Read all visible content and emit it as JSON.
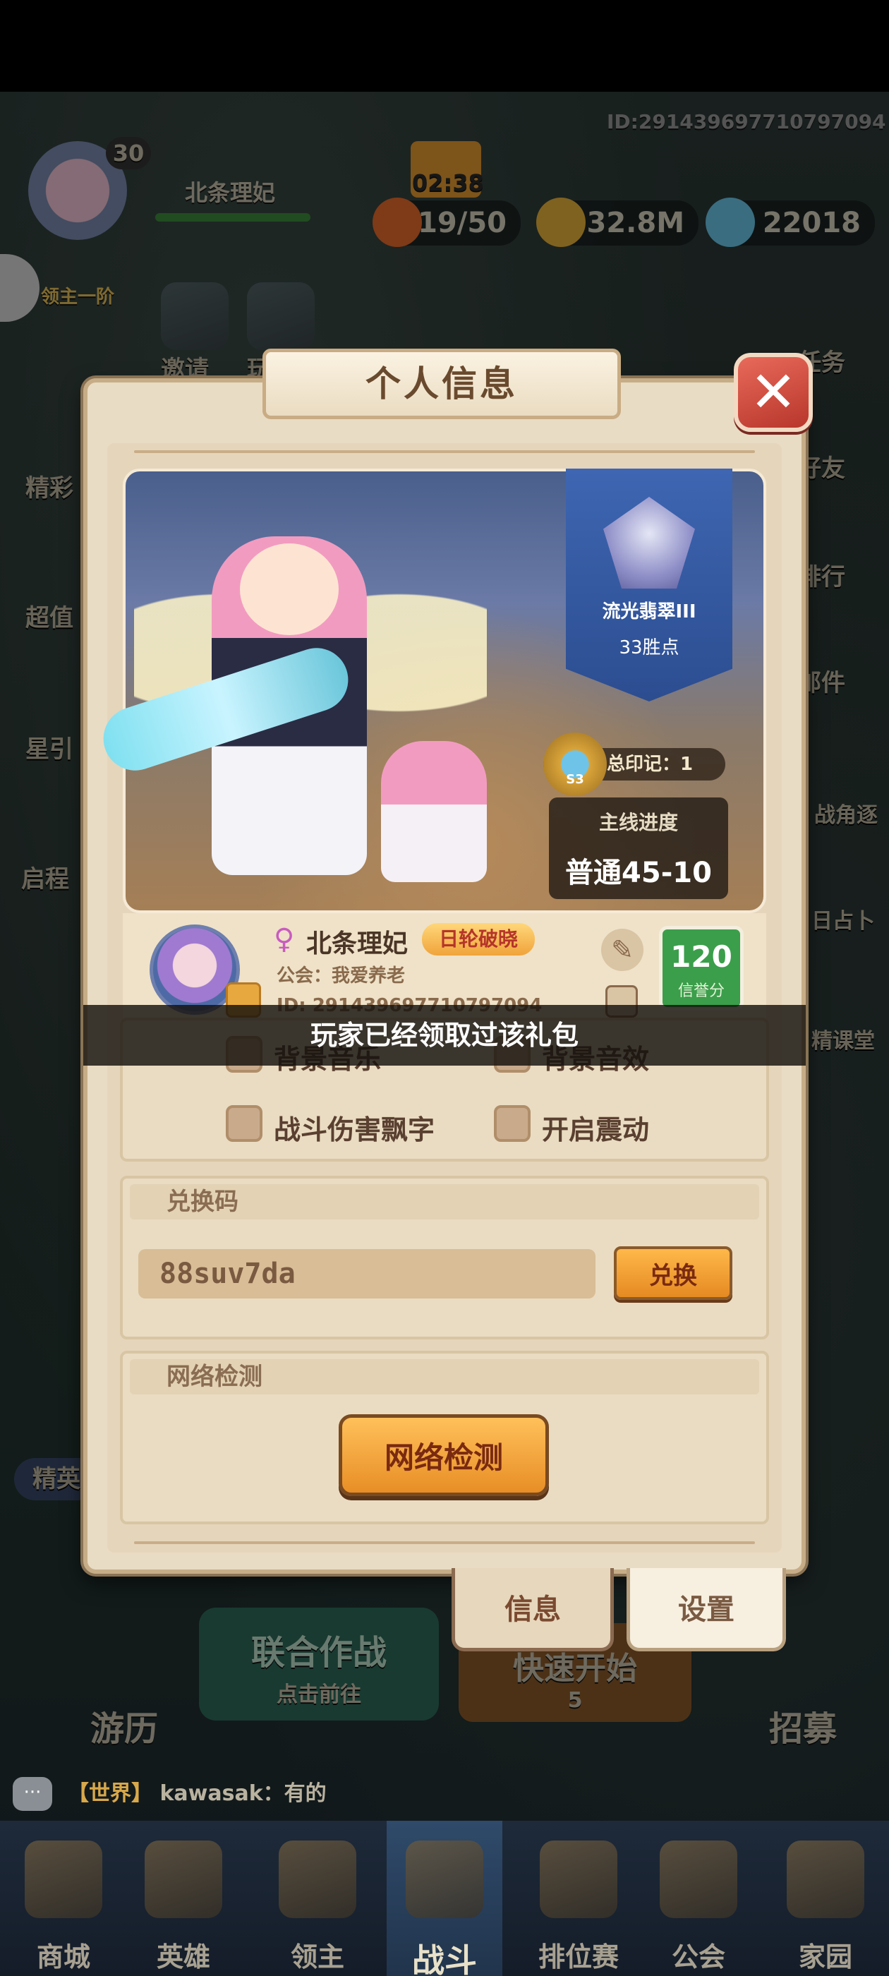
{
  "status": {
    "player_id": "ID:291439697710797094"
  },
  "hud": {
    "avatar_level": "30",
    "player_name": "北条理妃",
    "lord_tag": "领主一阶",
    "timer": "02:38",
    "energy": "19/50",
    "gold": "32.8M",
    "gems": "22018"
  },
  "side_left": [
    "邀请",
    "玩法入口",
    "精彩",
    "超值",
    "星引",
    "启程",
    "精英"
  ],
  "side_right": [
    "任务",
    "好友",
    "排行",
    "邮件",
    "战角逐",
    "日占卜",
    "精课堂"
  ],
  "modal": {
    "title": "个人信息",
    "close_icon": "close-icon",
    "rank": {
      "name": "流光翡翠III",
      "points": "33胜点"
    },
    "badge": {
      "season": "S3",
      "total_marks": "总印记：1"
    },
    "progress": {
      "label": "主线进度",
      "value": "普通45-10"
    },
    "player": {
      "name": "北条理妃",
      "title_tag": "日轮破晓",
      "guild": "公会：我爱养老",
      "id": "ID: 291439697710797094",
      "credit_value": "120",
      "credit_label": "信誉分"
    },
    "toast": "玩家已经领取过该礼包",
    "settings": {
      "bgm_label": "背景音乐",
      "sfx_label": "背景音效",
      "damage_text_label": "战斗伤害飘字",
      "vibration_label": "开启震动"
    },
    "redeem": {
      "header": "兑换码",
      "code_value": "88suv7da",
      "button_label": "兑换"
    },
    "network": {
      "header": "网络检测",
      "button_label": "网络检测"
    },
    "tabs": {
      "info": "信息",
      "settings": "设置"
    }
  },
  "background_buttons": {
    "joint_battle": "联合作战",
    "joint_battle_sub": "点击前往",
    "quick_start": "快速开始",
    "quick_cost": "5",
    "travel": "游历",
    "recruit": "招募"
  },
  "chat": {
    "icon": "chat-icon",
    "channel": "【世界】",
    "message": "kawasak：有的"
  },
  "bottom_nav": [
    {
      "label": "商城",
      "icon": "shop-icon"
    },
    {
      "label": "英雄",
      "icon": "hero-card-icon"
    },
    {
      "label": "领主",
      "icon": "lord-banner-icon"
    },
    {
      "label": "战斗",
      "icon": "sword-icon",
      "active": true
    },
    {
      "label": "排位赛",
      "icon": "rank-shield-icon"
    },
    {
      "label": "公会",
      "icon": "guild-castle-icon"
    },
    {
      "label": "家园",
      "icon": "home-castle-icon"
    }
  ],
  "colors": {
    "modal_bg": "#e9dcc4",
    "close_red": "#d04a3c",
    "credit_green": "#3b9e4b",
    "button_orange": "#f0a33a",
    "rank_blue": "#3e66b2"
  }
}
